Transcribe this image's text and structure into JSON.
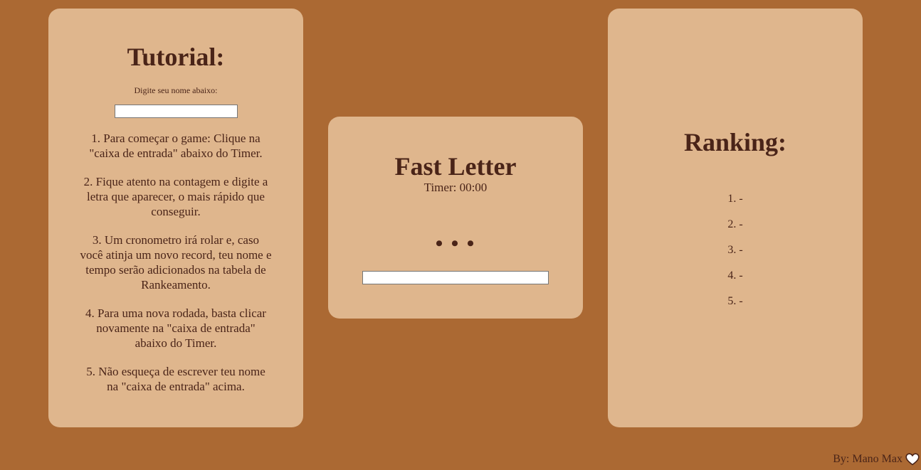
{
  "tutorial": {
    "title": "Tutorial:",
    "name_label": "Digite seu nome abaixo:",
    "name_input_value": "",
    "steps": [
      "1. Para começar o game: Clique na \"caixa de entrada\" abaixo do Timer.",
      "2. Fique atento na contagem e digite a letra que aparecer, o mais rápido que conseguir.",
      "3. Um cronometro irá rolar e, caso você atinja um novo record, teu nome e tempo serão adicionados na tabela de Rankeamento.",
      "4. Para uma nova rodada, basta clicar novamente na \"caixa de entrada\" abaixo do Timer.",
      "5. Não esqueça de escrever teu nome na \"caixa de entrada\" acima."
    ]
  },
  "game": {
    "title": "Fast Letter",
    "timer": "Timer: 00:00",
    "letter": "• • •",
    "input_value": ""
  },
  "ranking": {
    "title": "Ranking:",
    "items": [
      "1. -",
      "2. -",
      "3. -",
      "4. -",
      "5. -"
    ]
  },
  "footer": {
    "credit": "By: Mano Max",
    "icon": "heart-icon"
  },
  "colors": {
    "background": "#ab6933",
    "panel": "#dfb68d",
    "text": "#4a2418"
  }
}
